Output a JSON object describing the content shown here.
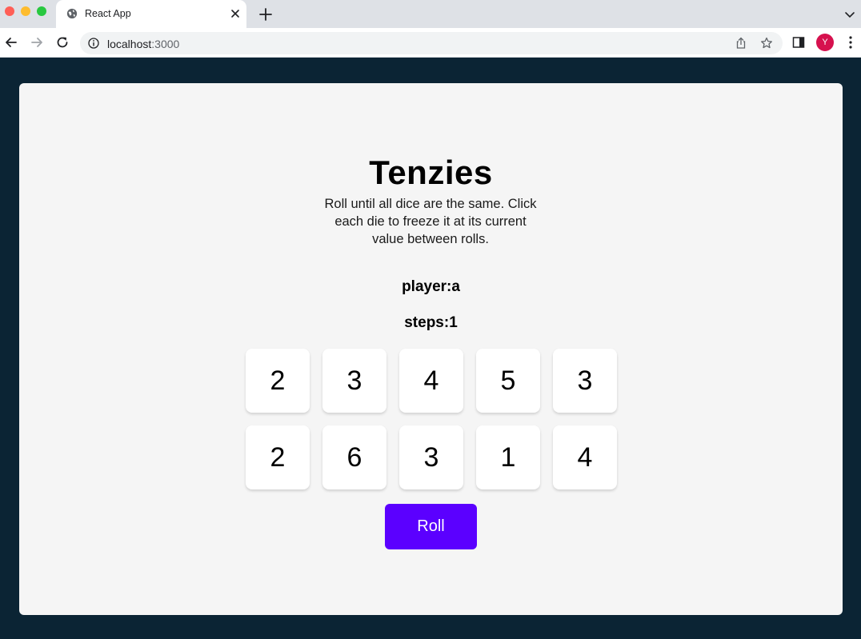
{
  "browser": {
    "tab_title": "React App",
    "url_host": "localhost",
    "url_port": ":3000",
    "avatar_initial": "Y"
  },
  "game": {
    "title": "Tenzies",
    "instructions": "Roll until all dice are the same. Click each die to freeze it at its current value between rolls.",
    "player": "player:a",
    "steps": "steps:1",
    "dice": [
      "2",
      "3",
      "4",
      "5",
      "3",
      "2",
      "6",
      "3",
      "1",
      "4"
    ],
    "roll_label": "Roll"
  },
  "colors": {
    "page_background": "#0B2434",
    "card_background": "#F5F5F5",
    "roll_button": "#5B00FF",
    "avatar": "#D6114E"
  },
  "icons": [
    "globe-icon",
    "close-icon",
    "plus-icon",
    "chevron-down-icon",
    "back-arrow-icon",
    "forward-arrow-icon",
    "reload-icon",
    "info-icon",
    "share-icon",
    "star-icon",
    "side-panel-icon",
    "kebab-menu-icon"
  ]
}
